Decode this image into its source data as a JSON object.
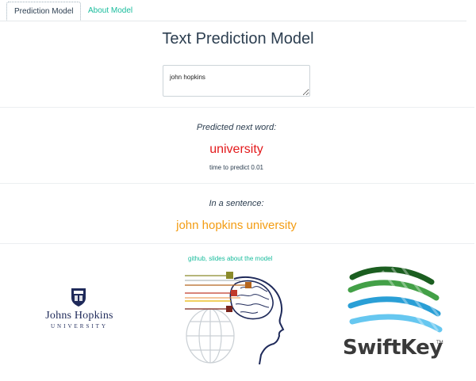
{
  "tabs": [
    {
      "label": "Prediction Model",
      "active": true
    },
    {
      "label": "About Model",
      "active": false
    }
  ],
  "page_title": "Text Prediction Model",
  "input": {
    "value": "john hopkins"
  },
  "prediction": {
    "heading": "Predicted next word:",
    "word": "university",
    "timing": "time to predict 0.01"
  },
  "sentence": {
    "heading": "In a sentence:",
    "text": "john hopkins university"
  },
  "links": {
    "github": "github,",
    "slides": "slides about the model"
  },
  "logos": {
    "jhu": {
      "name": "Johns Hopkins",
      "sub": "University"
    },
    "swiftkey": {
      "name": "SwiftKey",
      "tm": "TM"
    },
    "brain": "brain-icon"
  },
  "colors": {
    "accent": "#18bc9c",
    "prediction": "#e31a1c",
    "sentence": "#f39c12",
    "text": "#2c3e50"
  }
}
